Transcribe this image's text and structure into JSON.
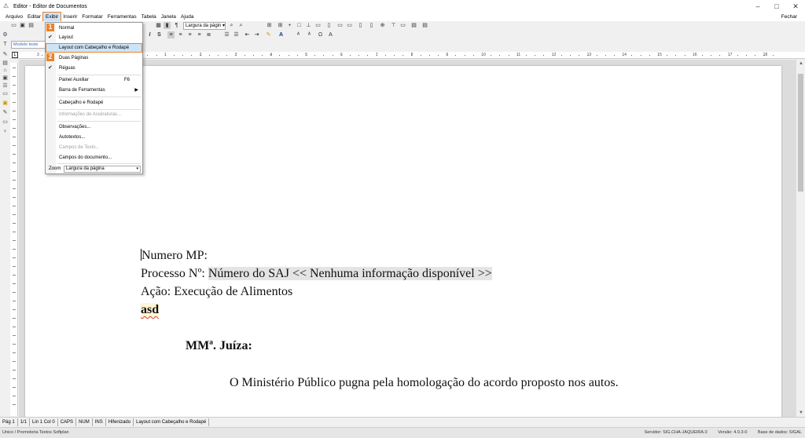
{
  "window": {
    "title": "Editor - Editor de Documentos",
    "icon": "app-icon",
    "controls": [
      "–",
      "□",
      "✕"
    ]
  },
  "menubar": {
    "items": [
      "Arquivo",
      "Editar",
      "Exibir",
      "Inserir",
      "Formatar",
      "Ferramentas",
      "Tabela",
      "Janela",
      "Ajuda"
    ],
    "active": "Exibir",
    "close_doc": "Fechar"
  },
  "toolbar": {
    "zoom_combo": "Largura da págin",
    "zoom_combo_arrow": "▾"
  },
  "model_field": "Modelo teste",
  "ruler": {
    "numbers": [
      "1",
      "2",
      "3",
      "4",
      "5",
      "6",
      "7",
      "8",
      "9",
      "10",
      "11",
      "12",
      "13",
      "14",
      "15",
      "16",
      "17",
      "18"
    ],
    "margin_left": "3"
  },
  "document": {
    "line1": "Numero MP:",
    "line2_label": "Processo Nº: ",
    "line2_field": "Número do SAJ << Nenhuma informação disponível >>",
    "line3": "Ação: Execução de Alimentos",
    "line4": "asd",
    "salutation": "MMª. Juíza:",
    "paragraph": "O Ministério Público pugna pela homologação do acordo proposto nos autos."
  },
  "menu": {
    "items": [
      {
        "label": "Normal",
        "checked": false
      },
      {
        "label": "Layout",
        "checked": true
      },
      {
        "label": "Layout com Cabeçalho e Rodapé",
        "checked": false
      },
      {
        "label": "Duas Páginas",
        "checked": false
      },
      {
        "label": "Réguas",
        "checked": true
      },
      {
        "label": "Painel Auxiliar",
        "shortcut": "F6"
      },
      {
        "label": "Barra de Ferramentas",
        "submenu": true
      },
      {
        "label": "Cabeçalho e Rodapé"
      },
      {
        "label": "Informações de Assinaturas...",
        "disabled": true
      },
      {
        "label": "Observações..."
      },
      {
        "label": "Autotextos..."
      },
      {
        "label": "Campos de Texto...",
        "disabled": true
      },
      {
        "label": "Campos do documento..."
      }
    ],
    "zoom_label": "Zoom",
    "zoom_value": "Largura da página"
  },
  "badges": {
    "one": "1",
    "two": "2"
  },
  "statusbar": {
    "page": "Pág 1",
    "pages": "1/1",
    "position": "Lin 1  Col 0",
    "caps": "CAPS",
    "num": "NUM",
    "ins": "INS",
    "hyphen": "Hifenizado",
    "layout": "Layout com Cabeçalho e Rodapé"
  },
  "infobar": {
    "left": "Unico / Promotoria Textos Softplan",
    "server": "Servidor: SIG.CHA-JAQUEIRA.0",
    "version": "Versão: 4.0.3-0",
    "database": "Base de dados: SIGAL"
  },
  "colors": {
    "accent": "#e8842c",
    "highlight": "#cde4f7"
  }
}
